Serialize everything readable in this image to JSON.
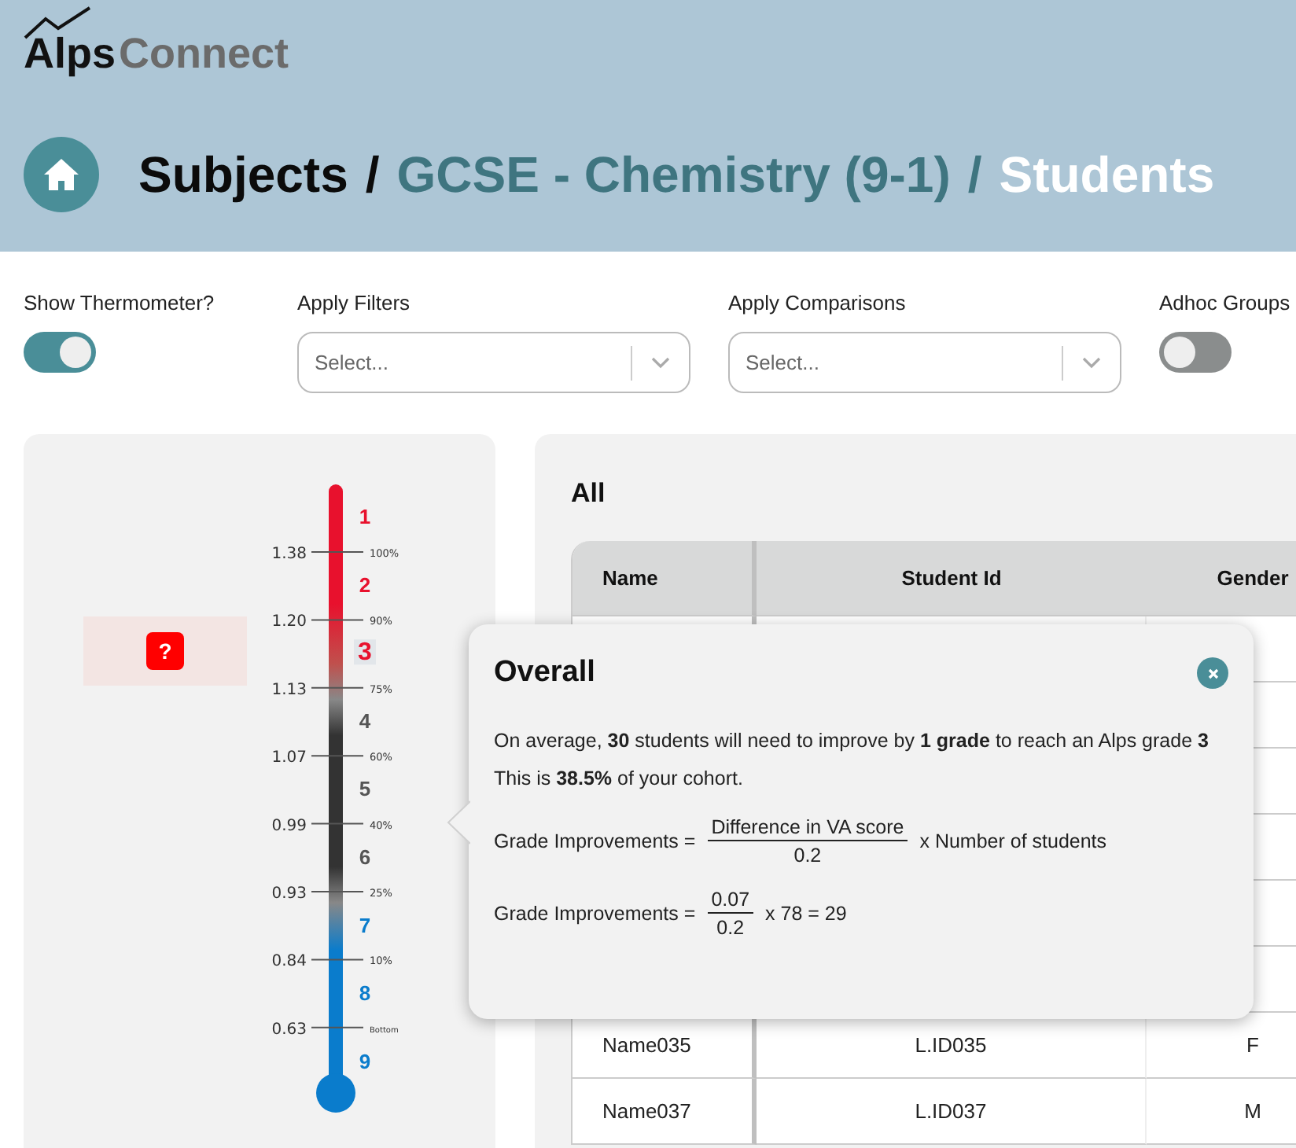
{
  "logo": {
    "part_1": "Alps",
    "part_2": "Connect"
  },
  "breadcrumb": [
    {
      "label": "Subjects",
      "kind": "root"
    },
    {
      "label": "/",
      "kind": "root"
    },
    {
      "label": "GCSE - Chemistry (9-1)",
      "kind": "middle"
    },
    {
      "label": "/",
      "kind": "middle"
    },
    {
      "label": "Students",
      "kind": "current"
    }
  ],
  "controls": [
    {
      "kind": "toggle",
      "label": "Show Thermometer?",
      "on": true
    },
    {
      "kind": "select",
      "label": "Apply Filters",
      "placeholder": "Select..."
    },
    {
      "kind": "select",
      "label": "Apply Comparisons",
      "placeholder": "Select..."
    },
    {
      "kind": "toggle",
      "label": "Adhoc Groups",
      "on": false
    }
  ],
  "thermometer": {
    "badge": "?",
    "ticks": [
      {
        "value": "1.38",
        "percent": "100%"
      },
      {
        "value": "1.20",
        "percent": "90%"
      },
      {
        "value": "1.13",
        "percent": "75%"
      },
      {
        "value": "1.07",
        "percent": "60%"
      },
      {
        "value": "0.99",
        "percent": "40%"
      },
      {
        "value": "0.93",
        "percent": "25%"
      },
      {
        "value": "0.84",
        "percent": "10%"
      },
      {
        "value": "0.63",
        "percent": "Bottom"
      }
    ],
    "grades": [
      {
        "label": "1",
        "color": "#e8112d",
        "selected": false
      },
      {
        "label": "2",
        "color": "#e8112d",
        "selected": false
      },
      {
        "label": "3",
        "color": "#e8112d",
        "selected": true
      },
      {
        "label": "4",
        "color": "#555555",
        "selected": false
      },
      {
        "label": "5",
        "color": "#555555",
        "selected": false
      },
      {
        "label": "6",
        "color": "#555555",
        "selected": false
      },
      {
        "label": "7",
        "color": "#0a7ccc",
        "selected": false
      },
      {
        "label": "8",
        "color": "#0a7ccc",
        "selected": false
      },
      {
        "label": "9",
        "color": "#0a7ccc",
        "selected": false
      }
    ]
  },
  "table": {
    "title": "All",
    "columns": [
      "Name",
      "Student Id",
      "Gender"
    ],
    "rows": [
      [
        "Name035",
        "L.ID035",
        "F"
      ],
      [
        "Name037",
        "L.ID037",
        "M"
      ]
    ]
  },
  "popover": {
    "title": "Overall",
    "paragraphs": [
      "On average, **30** students will need to improve by **1 grade** to reach an Alps grade **3**",
      "This is **38.5%** of your cohort."
    ],
    "formulas": [
      {
        "lhs": "Grade Improvements =",
        "numerator": "Difference in VA score",
        "denominator": "0.2",
        "rhs": "x Number of students"
      },
      {
        "lhs": "Grade Improvements =",
        "numerator": "0.07",
        "denominator": "0.2",
        "rhs": "x 78 = 29"
      }
    ]
  }
}
